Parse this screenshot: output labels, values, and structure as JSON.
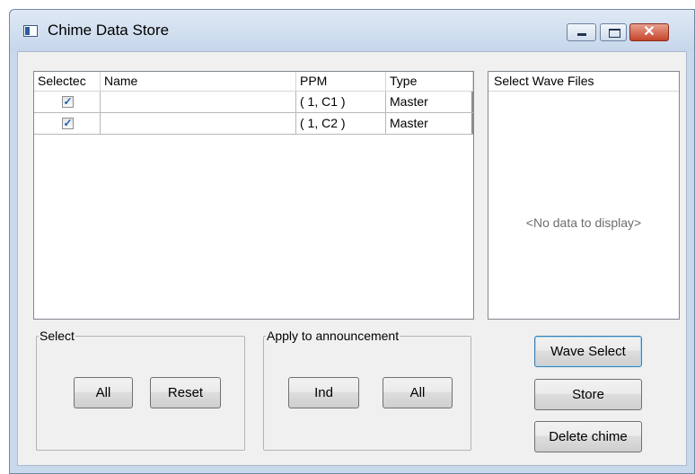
{
  "window": {
    "title": "Chime Data Store",
    "controls": {
      "minimize_icon": "minimize-icon",
      "maximize_icon": "maximize-icon",
      "close_icon": "close-icon",
      "close_glyph": "✕"
    }
  },
  "grid": {
    "columns": [
      "Selectec",
      "Name",
      "PPM",
      "Type"
    ],
    "rows": [
      {
        "selected": true,
        "selected_glyph": "✓",
        "name": "",
        "ppm": "( 1, C1 )",
        "type": "Master"
      },
      {
        "selected": true,
        "selected_glyph": "✓",
        "name": "",
        "ppm": "( 1, C2 )",
        "type": "Master"
      }
    ]
  },
  "wave_files": {
    "header": "Select Wave Files",
    "empty_text": "<No data to display>"
  },
  "select_group": {
    "label": "Select",
    "all_label": "All",
    "reset_label": "Reset"
  },
  "apply_group": {
    "label": "Apply to announcement",
    "ind_label": "Ind",
    "all_label": "All"
  },
  "actions": {
    "wave_select_label": "Wave Select",
    "store_label": "Store",
    "delete_label": "Delete chime"
  },
  "colors": {
    "accent": "#3c7fb1",
    "window_frame": "#c9d9ec",
    "checkmark": "#1e5fb3"
  }
}
